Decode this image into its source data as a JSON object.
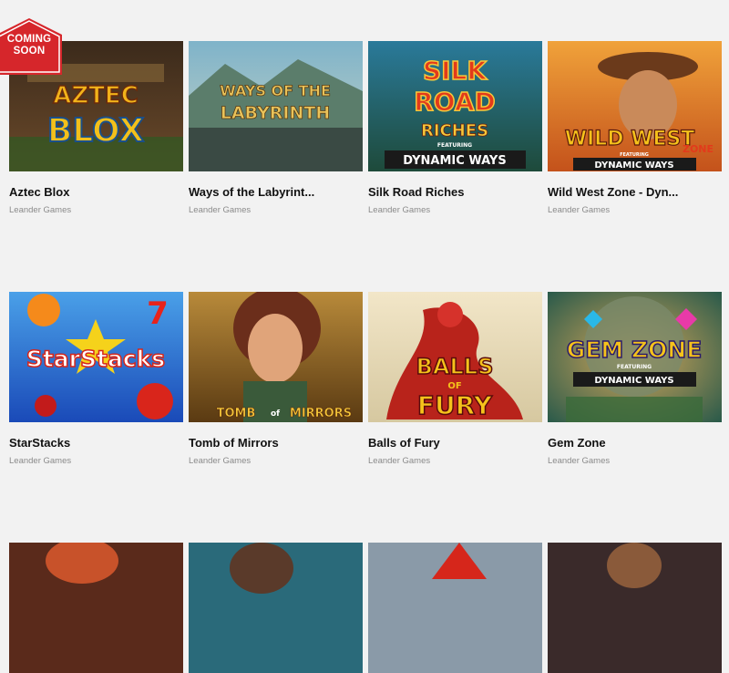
{
  "badge": {
    "line1": "COMING",
    "line2": "SOON",
    "color": "#d6262b"
  },
  "games": [
    {
      "title": "Aztec Blox",
      "provider": "Leander Games",
      "logo": [
        "AZTEC",
        "BLOX"
      ]
    },
    {
      "title": "Ways of the Labyrint...",
      "provider": "Leander Games",
      "logo": [
        "WAYS OF THE",
        "LABYRINTH"
      ]
    },
    {
      "title": "Silk Road Riches",
      "provider": "Leander Games",
      "logo": [
        "SILK",
        "ROAD",
        "RICHES",
        "FEATURING",
        "DYNAMIC WAYS"
      ]
    },
    {
      "title": "Wild West Zone - Dyn...",
      "provider": "Leander Games",
      "logo": [
        "WILD WEST",
        "ZONE",
        "FEATURING",
        "DYNAMIC WAYS"
      ]
    },
    {
      "title": "StarStacks",
      "provider": "Leander Games",
      "logo": [
        "StarStacks"
      ]
    },
    {
      "title": "Tomb of Mirrors",
      "provider": "Leander Games",
      "logo": [
        "TOMB",
        "of",
        "MIRRORS"
      ]
    },
    {
      "title": "Balls of Fury",
      "provider": "Leander Games",
      "logo": [
        "BALLS",
        "OF",
        "FURY"
      ]
    },
    {
      "title": "Gem Zone",
      "provider": "Leander Games",
      "logo": [
        "GEM ZONE",
        "FEATURING",
        "DYNAMIC WAYS"
      ]
    }
  ]
}
